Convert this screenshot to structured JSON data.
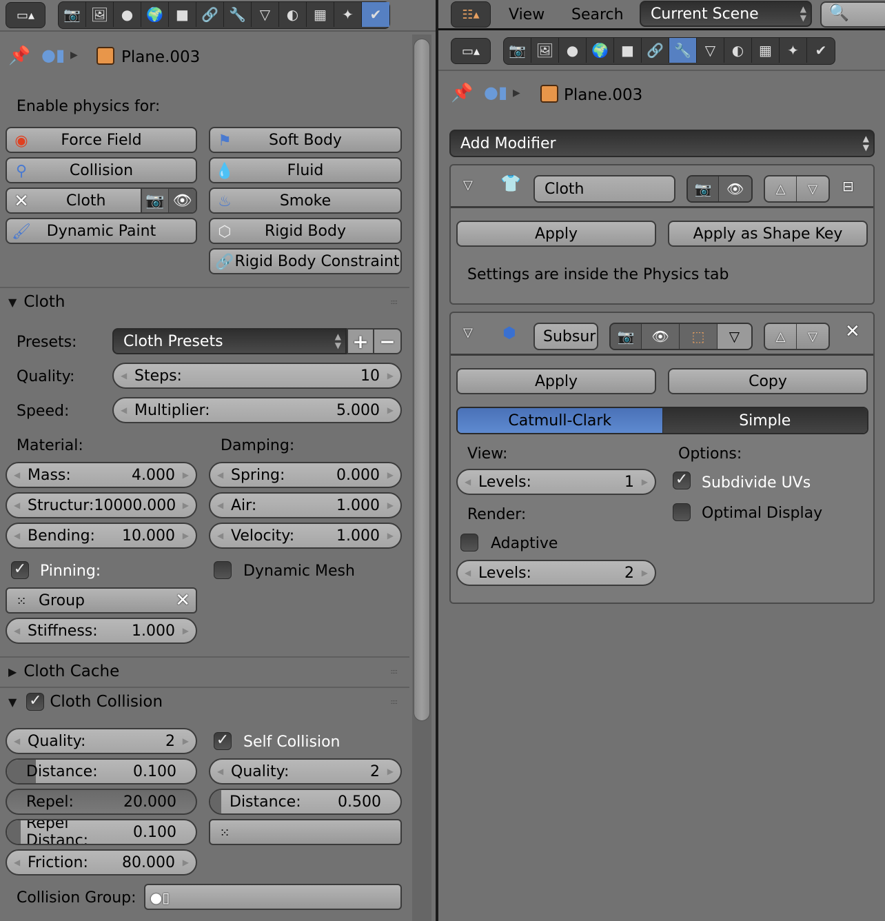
{
  "left": {
    "toolbar": {
      "editor_type_icon": "properties-editor-icon",
      "tabs": [
        {
          "name": "render",
          "icon": "camera-icon",
          "glyph": "📷",
          "active": false
        },
        {
          "name": "render-layers",
          "icon": "render-layers-icon",
          "glyph": "🖼",
          "active": false
        },
        {
          "name": "scene",
          "icon": "scene-icon",
          "glyph": "●",
          "active": false
        },
        {
          "name": "world",
          "icon": "world-icon",
          "glyph": "🌍",
          "active": false
        },
        {
          "name": "object",
          "icon": "object-icon",
          "glyph": "■",
          "active": false
        },
        {
          "name": "constraints",
          "icon": "constraints-icon",
          "glyph": "🔗",
          "active": false
        },
        {
          "name": "modifiers",
          "icon": "wrench-icon",
          "glyph": "🔧",
          "active": false
        },
        {
          "name": "data",
          "icon": "mesh-data-icon",
          "glyph": "▽",
          "active": false
        },
        {
          "name": "material",
          "icon": "material-icon",
          "glyph": "◐",
          "active": false
        },
        {
          "name": "texture",
          "icon": "texture-icon",
          "glyph": "▦",
          "active": false
        },
        {
          "name": "particles",
          "icon": "particles-icon",
          "glyph": "✦",
          "active": false
        },
        {
          "name": "physics",
          "icon": "physics-icon",
          "glyph": "✔",
          "active": true
        }
      ]
    },
    "breadcrumb": {
      "object": "Plane.003"
    },
    "enable_label": "Enable physics for:",
    "physics_buttons": {
      "force_field": "Force Field",
      "collision": "Collision",
      "cloth": "Cloth",
      "dynamic_paint": "Dynamic Paint",
      "soft_body": "Soft Body",
      "fluid": "Fluid",
      "smoke": "Smoke",
      "rigid_body": "Rigid Body",
      "rigid_body_constraint": "Rigid Body Constraint"
    },
    "cloth": {
      "title": "Cloth",
      "presets_label": "Presets:",
      "presets_value": "Cloth Presets",
      "quality_label": "Quality:",
      "steps_label": "Steps:",
      "steps_value": "10",
      "speed_label": "Speed:",
      "multiplier_label": "Multiplier:",
      "multiplier_value": "5.000",
      "material_label": "Material:",
      "damping_label": "Damping:",
      "mass_label": "Mass:",
      "mass_value": "4.000",
      "structural_label": "Structur:",
      "structural_value": "10000.000",
      "bending_label": "Bending:",
      "bending_value": "10.000",
      "spring_label": "Spring:",
      "spring_value": "0.000",
      "air_label": "Air:",
      "air_value": "1.000",
      "velocity_label": "Velocity:",
      "velocity_value": "1.000",
      "pinning_label": "Pinning:",
      "pinning_checked": true,
      "dynamic_mesh_label": "Dynamic Mesh",
      "dynamic_mesh_checked": false,
      "group_value": "Group",
      "stiffness_label": "Stiffness:",
      "stiffness_value": "1.000"
    },
    "cloth_cache": {
      "title": "Cloth Cache"
    },
    "cloth_collision": {
      "title": "Cloth Collision",
      "enabled": true,
      "quality_label": "Quality:",
      "quality_value": "2",
      "distance_label": "Distance:",
      "distance_value": "0.100",
      "distance_fraction": 0.1,
      "repel_label": "Repel:",
      "repel_value": "20.000",
      "repel_fraction": 1.0,
      "repel_distance_label": "Repel Distanc:",
      "repel_distance_value": "0.100",
      "repel_distance_fraction": 0.05,
      "friction_label": "Friction:",
      "friction_value": "80.000",
      "self_collision_label": "Self Collision",
      "self_collision_checked": true,
      "self_quality_label": "Quality:",
      "self_quality_value": "2",
      "self_distance_label": "Distance:",
      "self_distance_value": "0.500",
      "self_distance_fraction": 0.05,
      "collision_group_label": "Collision Group:"
    }
  },
  "right": {
    "header": {
      "menu_view": "View",
      "menu_search": "Search",
      "scene_select": "Current Scene"
    },
    "breadcrumb": {
      "object": "Plane.003"
    },
    "add_modifier": "Add Modifier",
    "cloth_modifier": {
      "name": "Cloth",
      "apply": "Apply",
      "apply_shape_key": "Apply as Shape Key",
      "info": "Settings are inside the Physics tab"
    },
    "subsurf_modifier": {
      "name": "Subsur",
      "apply": "Apply",
      "copy": "Copy",
      "type_options": [
        "Catmull-Clark",
        "Simple"
      ],
      "type_selected": "Catmull-Clark",
      "view_label": "View:",
      "view_levels_label": "Levels:",
      "view_levels_value": "1",
      "render_label": "Render:",
      "adaptive_label": "Adaptive",
      "adaptive_checked": false,
      "render_levels_label": "Levels:",
      "render_levels_value": "2",
      "options_label": "Options:",
      "subdivide_uvs_label": "Subdivide UVs",
      "subdivide_uvs_checked": true,
      "optimal_display_label": "Optimal Display",
      "optimal_display_checked": false
    }
  },
  "colors": {
    "accent": "#5680c2",
    "panel_bg": "#727272",
    "button_bg": "#a8a8a8",
    "dark_field": "#3a3a3a"
  }
}
